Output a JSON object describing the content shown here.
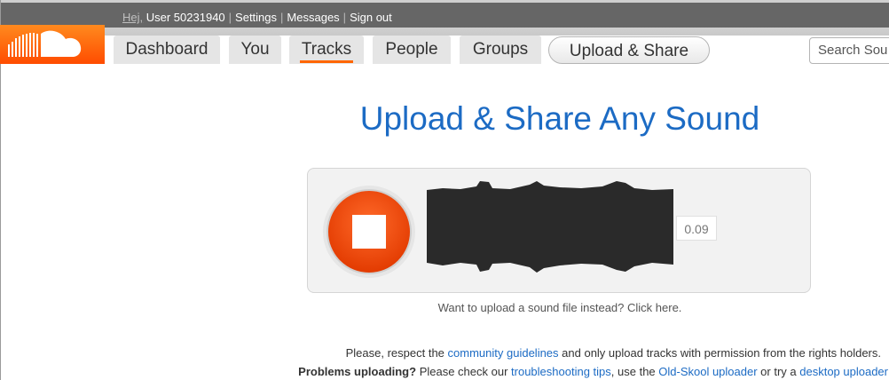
{
  "userbar": {
    "greeting": "Hej,",
    "user": "User 50231940",
    "settings": "Settings",
    "messages": "Messages",
    "signout": "Sign out"
  },
  "nav": {
    "tabs": [
      "Dashboard",
      "You",
      "Tracks",
      "People",
      "Groups"
    ],
    "active": "Tracks",
    "upload_share": "Upload & Share",
    "search_placeholder": "Search Sou"
  },
  "main": {
    "heading": "Upload & Share Any Sound",
    "recorder_time": "0.09",
    "upload_file_prompt": "Want to upload a sound file instead? Click here."
  },
  "notice": {
    "line1_a": "Please, respect the ",
    "line1_link": "community guidelines",
    "line1_b": " and only upload tracks with permission from the rights holders.",
    "line2_bold": "Problems uploading?",
    "line2_a": " Please check our ",
    "line2_link1": "troubleshooting tips",
    "line2_b": ", use the ",
    "line2_link2": "Old-Skool uploader",
    "line2_c": " or try a ",
    "line2_link3": "desktop uploader"
  },
  "colors": {
    "brand_orange": "#ff6600",
    "link_blue": "#1c6bc4"
  },
  "icons": [
    "soundcloud-logo",
    "stop-record-icon"
  ]
}
